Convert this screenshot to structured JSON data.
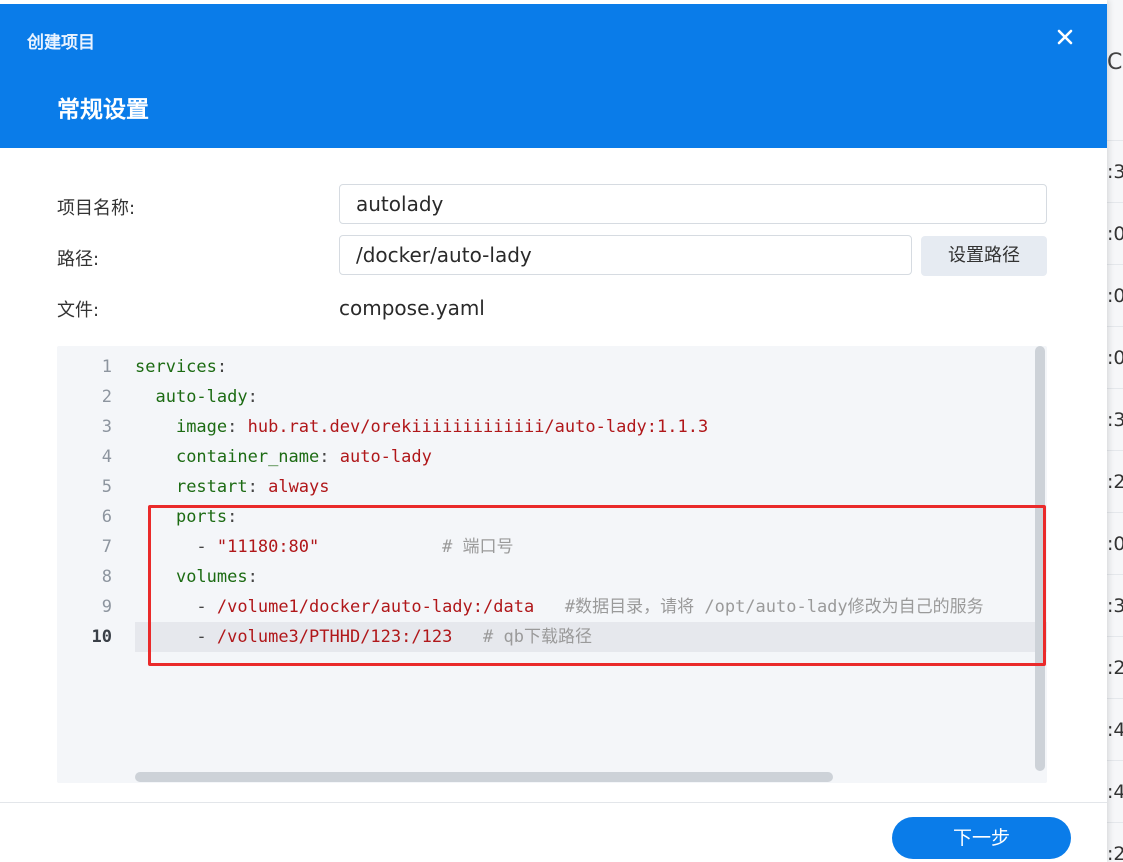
{
  "dialog": {
    "window_title": "创建项目",
    "section_title": "常规设置",
    "close_icon": "close-icon"
  },
  "form": {
    "project_name_label": "项目名称:",
    "project_name_value": "autolady",
    "path_label": "路径:",
    "path_value": "/docker/auto-lady",
    "set_path_button": "设置路径",
    "file_label": "文件:",
    "file_value": "compose.yaml"
  },
  "editor": {
    "active_line": 10,
    "lines": [
      {
        "num": "1",
        "indent": "",
        "key": "services",
        "sep": ":",
        "value": "",
        "comment": ""
      },
      {
        "num": "2",
        "indent": "  ",
        "key": "auto-lady",
        "sep": ":",
        "value": "",
        "comment": ""
      },
      {
        "num": "3",
        "indent": "    ",
        "key": "image",
        "sep": ": ",
        "value": "hub.rat.dev/orekiiiiiiiiiiiii/auto-lady:1.1.3",
        "comment": ""
      },
      {
        "num": "4",
        "indent": "    ",
        "key": "container_name",
        "sep": ": ",
        "value": "auto-lady",
        "comment": ""
      },
      {
        "num": "5",
        "indent": "    ",
        "key": "restart",
        "sep": ": ",
        "value": "always",
        "comment": ""
      },
      {
        "num": "6",
        "indent": "    ",
        "key": "ports",
        "sep": ":",
        "value": "",
        "comment": ""
      },
      {
        "num": "7",
        "indent": "      ",
        "key": "",
        "sep": "- ",
        "value": "\"11180:80\"",
        "comment": "            # 端口号"
      },
      {
        "num": "8",
        "indent": "    ",
        "key": "volumes",
        "sep": ":",
        "value": "",
        "comment": ""
      },
      {
        "num": "9",
        "indent": "      ",
        "key": "",
        "sep": "- ",
        "value": "/volume1/docker/auto-lady:/data",
        "comment": "   #数据目录，请将 /opt/auto-lady修改为自己的服务"
      },
      {
        "num": "10",
        "indent": "      ",
        "key": "",
        "sep": "- ",
        "value": "/volume3/PTHHD/123:/123",
        "comment": "   # qb下载路径"
      }
    ]
  },
  "footer": {
    "next_button": "下一步"
  },
  "background_window": {
    "top_glyph": "C",
    "row_fragments": [
      ":3",
      ":0",
      ":0",
      ":0",
      ":3",
      ":2",
      ":0",
      ":3",
      ":2",
      ":4",
      ":4",
      ":2"
    ]
  },
  "colors": {
    "header": "#0a7ce9",
    "primary_button": "#0a7ce9",
    "highlight": "#ea2a2a",
    "yaml_key": "#1c6b13",
    "yaml_string": "#b0171a",
    "comment": "#9a9a9a"
  }
}
